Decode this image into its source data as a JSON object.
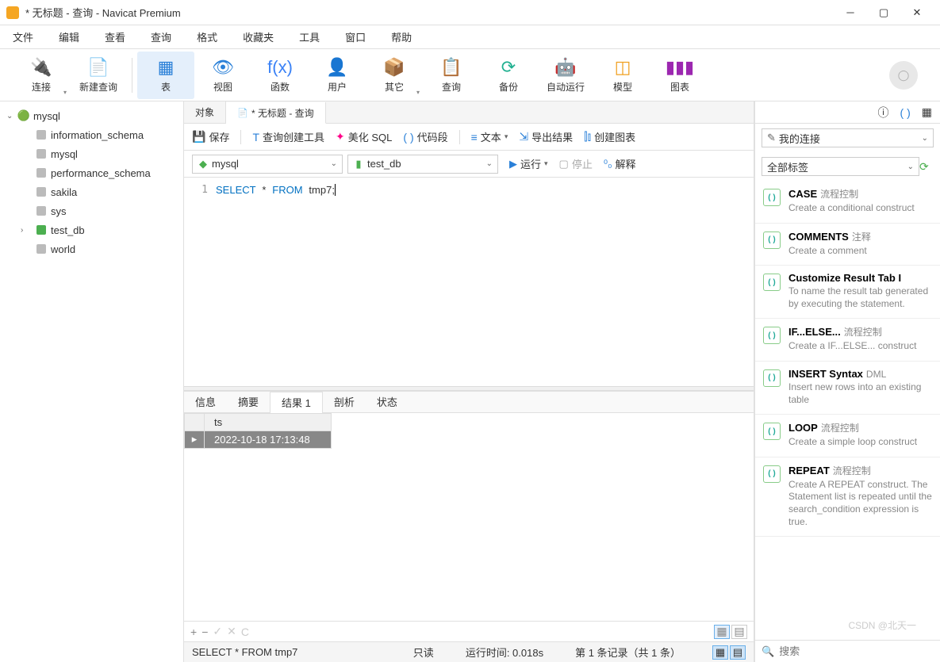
{
  "window": {
    "title": "* 无标题 - 查询 - Navicat Premium"
  },
  "menu": {
    "items": [
      "文件",
      "编辑",
      "查看",
      "查询",
      "格式",
      "收藏夹",
      "工具",
      "窗口",
      "帮助"
    ]
  },
  "toolbar": {
    "items": [
      {
        "label": "连接",
        "icon": "🔌",
        "dropdown": true
      },
      {
        "label": "新建查询",
        "icon": "📄"
      },
      {
        "label": "表",
        "icon": "▦",
        "active": true
      },
      {
        "label": "视图",
        "icon": "👁"
      },
      {
        "label": "函数",
        "icon": "f(x)",
        "color": "#3b82f6"
      },
      {
        "label": "用户",
        "icon": "👤",
        "color": "#f0a020"
      },
      {
        "label": "其它",
        "icon": "📦",
        "dropdown": true
      },
      {
        "label": "查询",
        "icon": "📋"
      },
      {
        "label": "备份",
        "icon": "⟳",
        "color": "#20b090"
      },
      {
        "label": "自动运行",
        "icon": "🤖",
        "color": "#20b090"
      },
      {
        "label": "模型",
        "icon": "◫",
        "color": "#f0a020"
      },
      {
        "label": "图表",
        "icon": "▮▮▮",
        "color": "#9c27b0"
      }
    ]
  },
  "tree": {
    "connection": "mysql",
    "databases": [
      "information_schema",
      "mysql",
      "performance_schema",
      "sakila",
      "sys",
      "test_db",
      "world"
    ],
    "active": "test_db"
  },
  "tabs": {
    "items": [
      {
        "label": "对象",
        "active": false
      },
      {
        "label": "* 无标题 - 查询",
        "active": true
      }
    ]
  },
  "query_toolbar": {
    "save": "保存",
    "build": "查询创建工具",
    "beautify": "美化 SQL",
    "snippet": "代码段",
    "text": "文本",
    "export": "导出结果",
    "chart": "创建图表"
  },
  "conn_row": {
    "conn": "mysql",
    "db": "test_db",
    "run": "运行",
    "stop": "停止",
    "explain": "解释"
  },
  "editor": {
    "line": "1",
    "kw_select": "SELECT",
    "star": "*",
    "kw_from": "FROM",
    "table": "tmp7",
    "semi": ";"
  },
  "result_tabs": [
    "信息",
    "摘要",
    "结果 1",
    "剖析",
    "状态"
  ],
  "result_active": "结果 1",
  "result": {
    "columns": [
      "ts"
    ],
    "rows": [
      [
        "2022-10-18 17:13:48"
      ]
    ]
  },
  "grid_footer": {
    "plus": "+",
    "minus": "−",
    "check": "✓",
    "x": "✕",
    "c": "C"
  },
  "statusbar": {
    "sql": "SELECT * FROM tmp7",
    "readonly": "只读",
    "runtime": "运行时间: 0.018s",
    "records": "第 1 条记录（共 1 条）"
  },
  "right": {
    "conn_filter": "我的连接",
    "tag_filter": "全部标签",
    "search_placeholder": "搜索",
    "snippets": [
      {
        "title": "CASE",
        "tag": "流程控制",
        "desc": "Create a conditional construct"
      },
      {
        "title": "COMMENTS",
        "tag": "注释",
        "desc": "Create a comment"
      },
      {
        "title": "Customize Result Tab I",
        "tag": "",
        "desc": "To name the result tab generated by executing the statement."
      },
      {
        "title": "IF...ELSE...",
        "tag": "流程控制",
        "desc": "Create a IF...ELSE... construct"
      },
      {
        "title": "INSERT Syntax",
        "tag": "DML",
        "desc": "Insert new rows into an existing table"
      },
      {
        "title": "LOOP",
        "tag": "流程控制",
        "desc": "Create a simple loop construct"
      },
      {
        "title": "REPEAT",
        "tag": "流程控制",
        "desc": "Create A REPEAT construct. The Statement list is repeated until the search_condition expression is true."
      }
    ]
  },
  "watermark": "CSDN @北天一"
}
